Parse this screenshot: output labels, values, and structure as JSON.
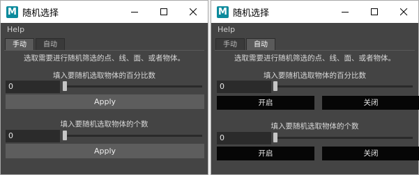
{
  "windows": [
    {
      "title": "随机选择",
      "app_icon_letter": "M",
      "menu": [
        "Help"
      ],
      "tabs": [
        {
          "label": "手动",
          "active": true
        },
        {
          "label": "自动",
          "active": false
        }
      ],
      "description": "选取需要进行随机筛选的点、线、面、或者物体。",
      "percent_section": {
        "label": "填入要随机选取物体的百分比数",
        "value": "0",
        "apply_label": "Apply"
      },
      "count_section": {
        "label": "填入要随机选取物体的个数",
        "value": "0",
        "apply_label": "Apply"
      }
    },
    {
      "title": "随机选择",
      "app_icon_letter": "M",
      "menu": [
        "Help"
      ],
      "tabs": [
        {
          "label": "手动",
          "active": false
        },
        {
          "label": "自动",
          "active": true
        }
      ],
      "description": "选取需要进行随机筛选的点、线、面、或者物体。",
      "percent_section": {
        "label": "填入要随机选取物体的百分比数",
        "value": "0",
        "on_label": "开启",
        "off_label": "关闭"
      },
      "count_section": {
        "label": "填入要随机选取物体的个数",
        "value": "0",
        "on_label": "开启",
        "off_label": "关闭"
      }
    }
  ],
  "colors": {
    "window_bg": "#444444",
    "field_bg": "#2b2b2b",
    "button_bg": "#5d5d5d",
    "black_button_bg": "#060606",
    "icon_teal": "#0b8a9c"
  }
}
